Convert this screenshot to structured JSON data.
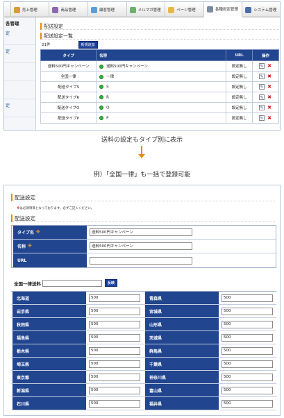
{
  "screen1": {
    "nav_tabs": [
      {
        "label": "",
        "icon": "tab-edge-icon"
      },
      {
        "label": "売上管理",
        "icon": "sales-icon"
      },
      {
        "label": "商品管理",
        "icon": "product-icon"
      },
      {
        "label": "顧客管理",
        "icon": "customer-icon"
      },
      {
        "label": "メルマガ管理",
        "icon": "mail-icon"
      },
      {
        "label": "ページ管理",
        "icon": "page-icon"
      },
      {
        "label": "各種設定管理",
        "icon": "settings-icon"
      },
      {
        "label": "システム管理",
        "icon": "system-icon"
      }
    ],
    "sidebar": {
      "heading": "各管理",
      "items": [
        "定",
        "定",
        "",
        "",
        "定",
        "",
        ""
      ]
    },
    "page_title": "配送設定",
    "section_title": "配送設定一覧",
    "count": "21件",
    "add_button": "新規追加",
    "table": {
      "headers": [
        "タイプ",
        "名称",
        "URL",
        "操作"
      ],
      "rows": [
        {
          "type": "送料500円キャンペーン",
          "name": "送料500円キャンペーン",
          "url": "設定無し"
        },
        {
          "type": "全国一律",
          "name": "一律",
          "url": "設定無し"
        },
        {
          "type": "配送タイプS",
          "name": "S",
          "url": "設定無し"
        },
        {
          "type": "配送タイプR",
          "name": "R",
          "url": "設定無し"
        },
        {
          "type": "配送タイプO",
          "name": "O",
          "url": "設定無し"
        },
        {
          "type": "配送タイプP",
          "name": "P",
          "url": "設定無し"
        }
      ]
    }
  },
  "caption1": "送料の設定もタイプ別に表示",
  "caption2": "例）「全国一律」も一括で登録可能",
  "screen2": {
    "page_title": "配送設定",
    "note": "は必須項目となっております。必ずご記入ください。",
    "note_mark": "※",
    "section_title": "配送設定",
    "form": [
      {
        "label": "タイプ名",
        "required": "※",
        "value": "送料500円キャンペーン"
      },
      {
        "label": "名称",
        "required": "※",
        "value": "送料500円キャンペーン"
      },
      {
        "label": "URL",
        "required": "",
        "value": ""
      }
    ],
    "bulk_label": "全国一律送料",
    "bulk_button": "反映",
    "prefectures": [
      [
        "北海道",
        "500",
        "青森県",
        "500"
      ],
      [
        "岩手県",
        "500",
        "宮城県",
        "500"
      ],
      [
        "秋田県",
        "500",
        "山形県",
        "500"
      ],
      [
        "福島県",
        "500",
        "茨城県",
        "500"
      ],
      [
        "栃木県",
        "500",
        "群馬県",
        "500"
      ],
      [
        "埼玉県",
        "500",
        "千葉県",
        "500"
      ],
      [
        "東京都",
        "500",
        "神奈川県",
        "500"
      ],
      [
        "新潟県",
        "500",
        "富山県",
        "500"
      ],
      [
        "石川県",
        "500",
        "福井県",
        "500"
      ]
    ]
  },
  "colors": {
    "accent": "#e58a0c",
    "header_blue": "#21458f",
    "button_blue": "#1c3f99",
    "delete_red": "#d21b1b",
    "active_green": "#38b23c"
  }
}
